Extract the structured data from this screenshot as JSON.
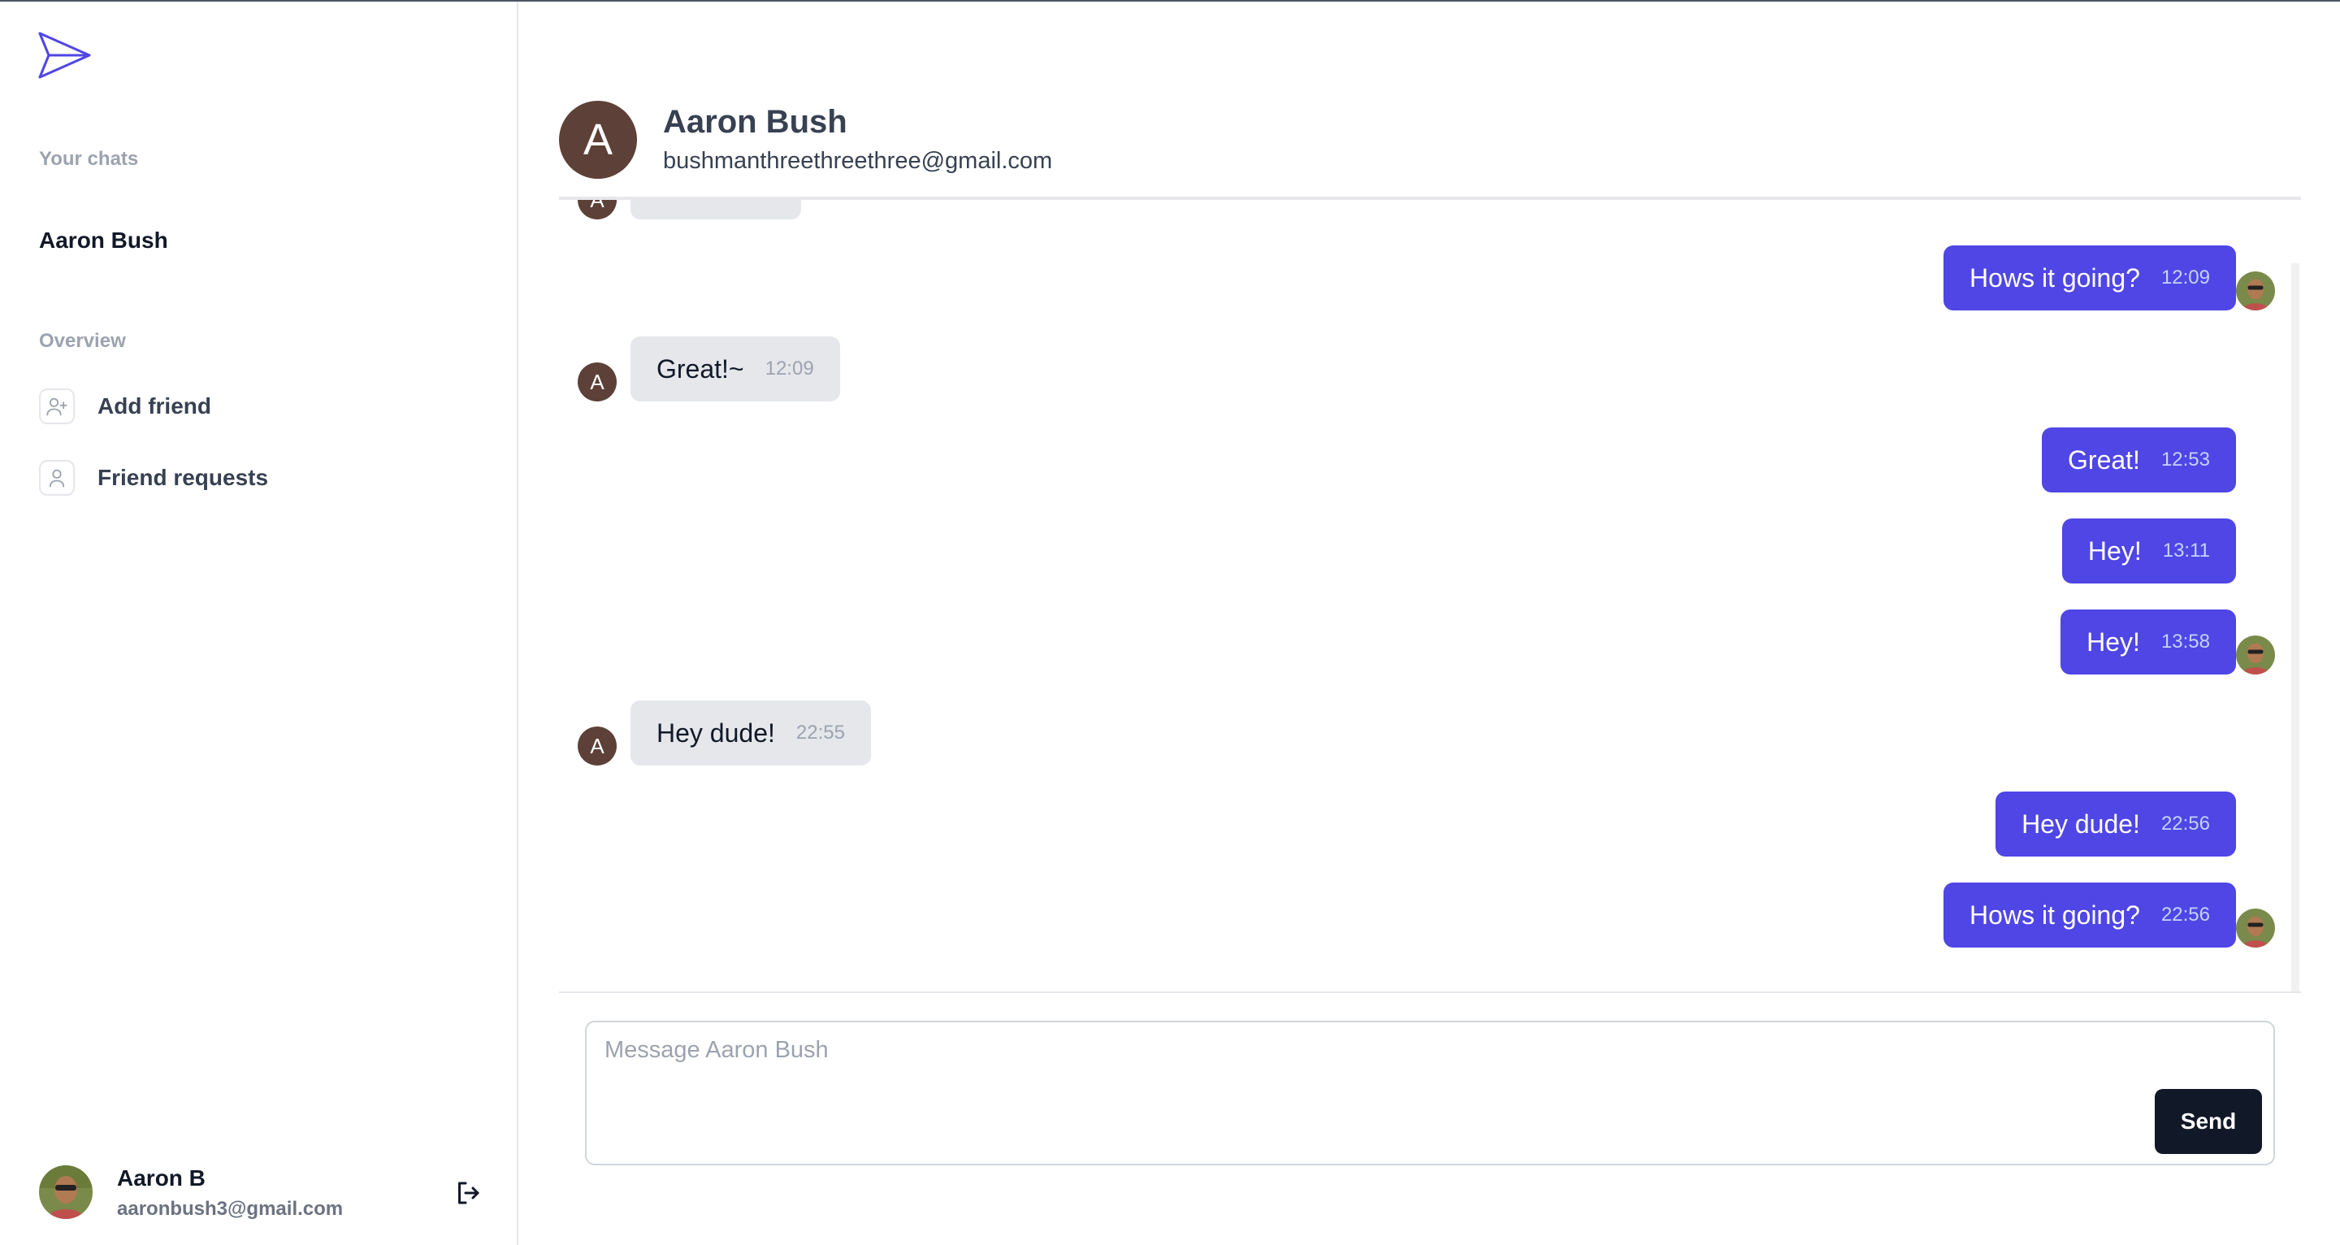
{
  "sidebar": {
    "your_chats_label": "Your chats",
    "chats": [
      {
        "name": "Aaron Bush"
      }
    ],
    "overview_label": "Overview",
    "nav": [
      {
        "label": "Add friend",
        "icon": "user-plus-icon"
      },
      {
        "label": "Friend requests",
        "icon": "user-icon"
      }
    ],
    "user": {
      "name": "Aaron B",
      "email": "aaronbush3@gmail.com"
    }
  },
  "chat": {
    "partner": {
      "initial": "A",
      "name": "Aaron Bush",
      "email": "bushmanthreethreethree@gmail.com"
    },
    "messages": [
      {
        "from": "me",
        "text": "Hows it going?",
        "time": "12:09"
      },
      {
        "from": "them",
        "text": "Great!~",
        "time": "12:09"
      },
      {
        "from": "me",
        "text": "Great!",
        "time": "12:53"
      },
      {
        "from": "me",
        "text": "Hey!",
        "time": "13:11"
      },
      {
        "from": "me",
        "text": "Hey!",
        "time": "13:58"
      },
      {
        "from": "them",
        "text": "Hey dude!",
        "time": "22:55"
      },
      {
        "from": "me",
        "text": "Hey dude!",
        "time": "22:56"
      },
      {
        "from": "me",
        "text": "Hows it going?",
        "time": "22:56"
      }
    ]
  },
  "composer": {
    "placeholder": "Message Aaron Bush",
    "send_label": "Send"
  },
  "colors": {
    "accent": "#4f46e5",
    "incoming": "#e5e7eb",
    "avatar": "#5d4037",
    "send_button": "#111827"
  }
}
